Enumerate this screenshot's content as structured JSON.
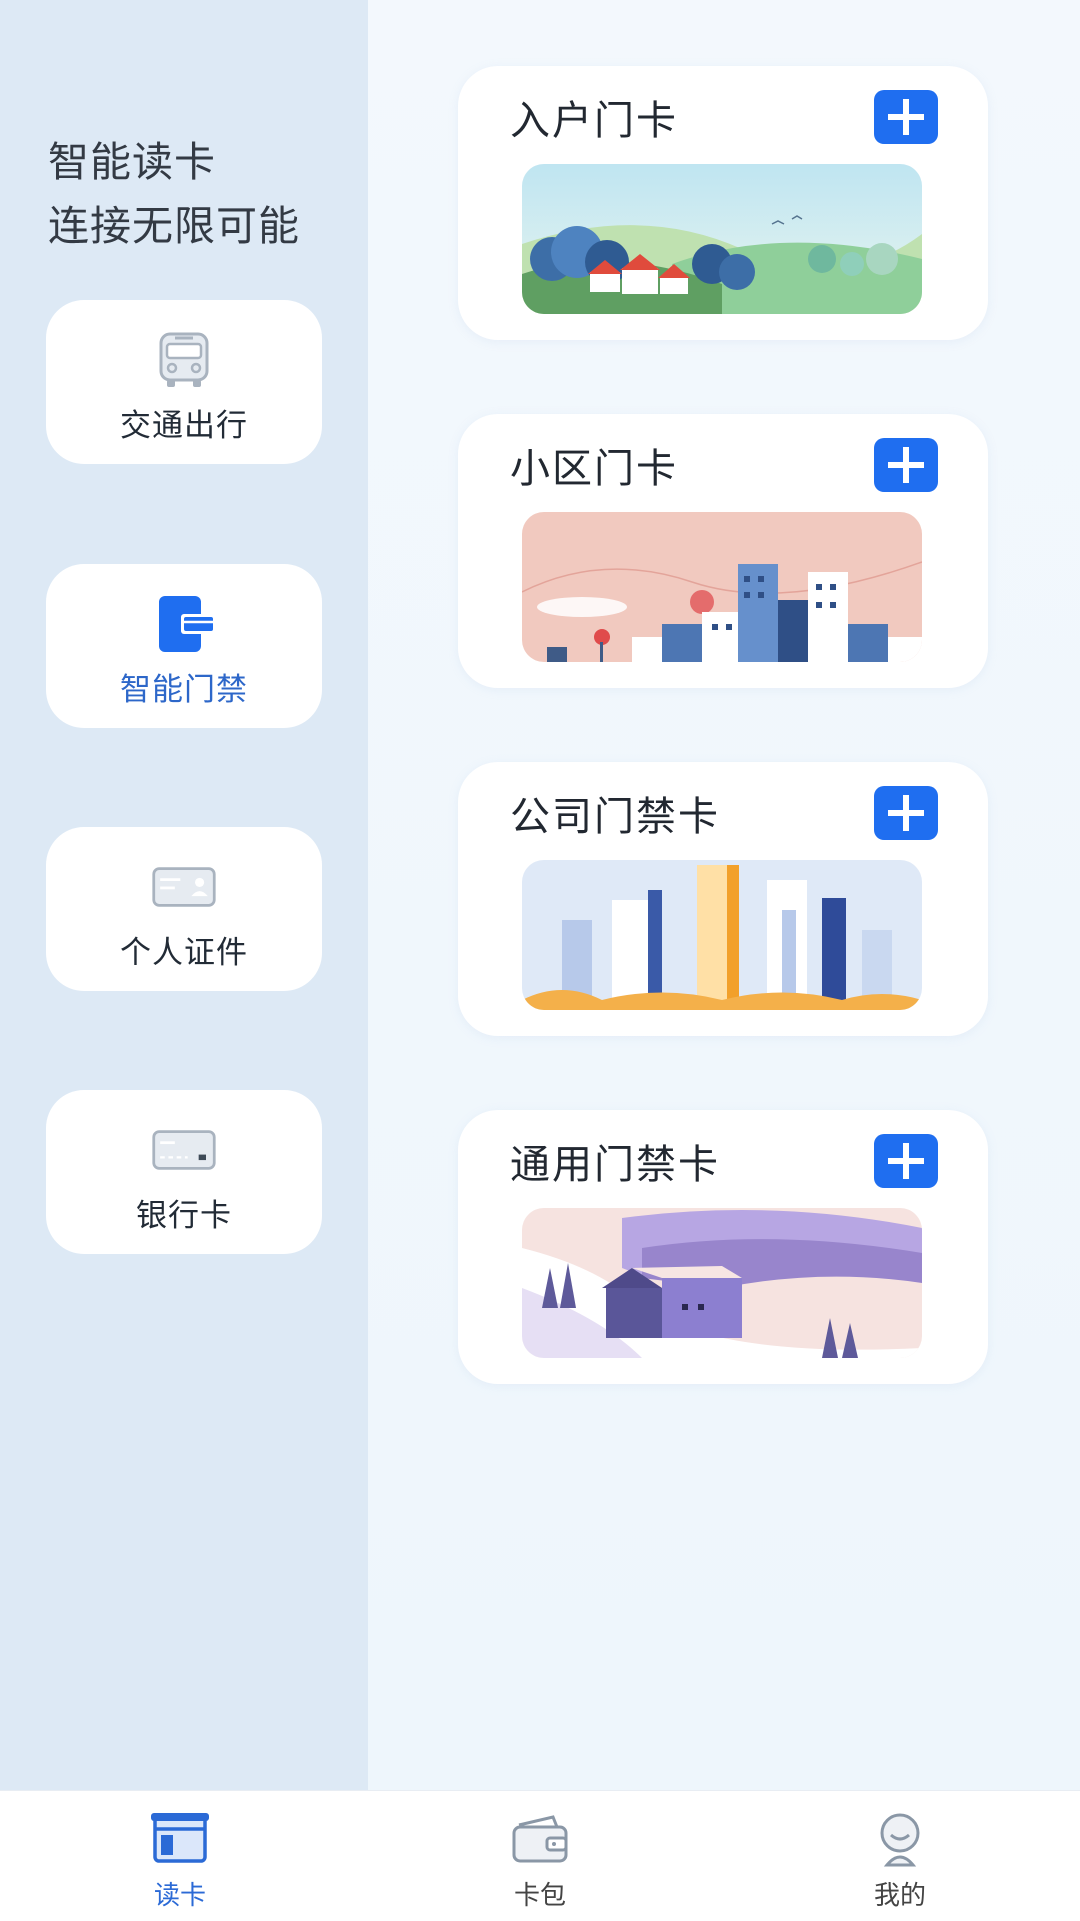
{
  "sidebar": {
    "slogan_line1": "智能读卡",
    "slogan_line2": "连接无限可能",
    "items": [
      {
        "label": "交通出行",
        "icon": "bus-icon"
      },
      {
        "label": "智能门禁",
        "icon": "door-card-icon",
        "active": true
      },
      {
        "label": "个人证件",
        "icon": "id-card-icon"
      },
      {
        "label": "银行卡",
        "icon": "bank-card-icon"
      }
    ]
  },
  "cards": [
    {
      "title": "入户门卡",
      "scene": "green-hills-village"
    },
    {
      "title": "小区门卡",
      "scene": "pink-city-skyline"
    },
    {
      "title": "公司门禁卡",
      "scene": "office-towers"
    },
    {
      "title": "通用门禁卡",
      "scene": "snowy-house"
    }
  ],
  "tabbar": {
    "items": [
      {
        "label": "读卡",
        "icon": "card-reader-icon",
        "active": true
      },
      {
        "label": "卡包",
        "icon": "wallet-icon"
      },
      {
        "label": "我的",
        "icon": "profile-icon"
      }
    ]
  },
  "colors": {
    "accent": "#1f6ef0",
    "active_text": "#2d67c9",
    "sidebar_bg": "#dde9f5"
  }
}
